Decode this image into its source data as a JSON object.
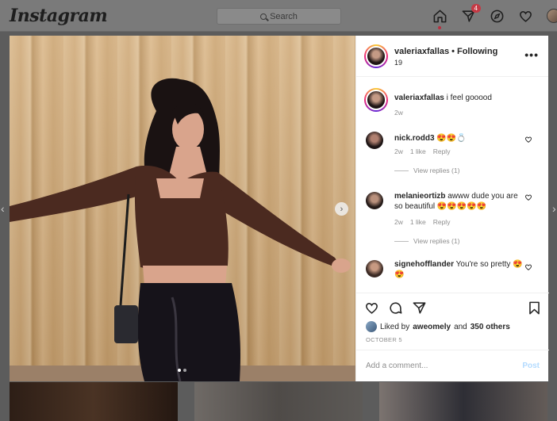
{
  "topnav": {
    "logo": "Instagram",
    "search_placeholder": "Search",
    "notifications_count": "4"
  },
  "post": {
    "author": "valeriaxfallas",
    "follow_status": "Following",
    "header_sub": "19",
    "more_label": "•••",
    "caption_user": "valeriaxfallas",
    "caption_text": "i feel gooood",
    "caption_time": "2w",
    "likes_prefix": "Liked by",
    "likes_user": "aweomely",
    "likes_and": "and",
    "likes_others": "350 others",
    "date": "OCTOBER 5",
    "comment_placeholder": "Add a comment...",
    "post_label": "Post"
  },
  "comments": [
    {
      "user": "nick.rodd3",
      "text": "😍😍💍",
      "time": "2w",
      "likes": "1 like",
      "reply": "Reply",
      "view_replies": "View replies (1)"
    },
    {
      "user": "melanieortizb",
      "text": "awww dude you are so beautiful 😍😍😍😍😍",
      "time": "2w",
      "likes": "1 like",
      "reply": "Reply",
      "view_replies": "View replies (1)"
    },
    {
      "user": "signehofflander",
      "text": "You're so pretty 😍😍"
    }
  ],
  "colors": {
    "brand_text": "#262626",
    "muted": "#8e8e8e",
    "post_button_disabled": "#b3dbff",
    "notification_badge": "#c43a45"
  },
  "icons": {
    "nav": [
      "home-icon",
      "direct-icon",
      "explore-icon",
      "activity-heart-icon",
      "profile-avatar"
    ],
    "actions": [
      "like-icon",
      "comment-icon",
      "share-icon",
      "save-icon"
    ]
  }
}
